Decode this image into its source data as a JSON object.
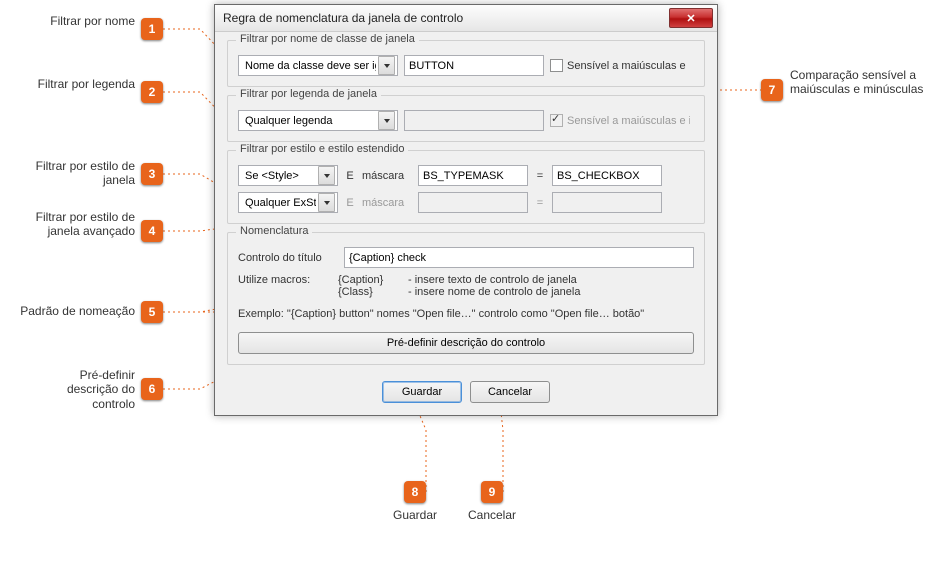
{
  "dialog": {
    "title": "Regra de nomenclatura da janela de controlo",
    "groups": {
      "classname": {
        "title": "Filtrar por nome de classe de janela",
        "combo": "Nome da classe deve ser igua",
        "value": "BUTTON",
        "case_label": "Sensível a maiúsculas e"
      },
      "caption": {
        "title": "Filtrar por legenda de janela",
        "combo": "Qualquer legenda",
        "value": "",
        "case_label": "Sensível a maiúsculas e i"
      },
      "style": {
        "title": "Filtrar por estilo e estilo estendido",
        "style_combo": "Se  <Style>",
        "and1": "E",
        "mask1_label": "máscara",
        "mask1_value": "BS_TYPEMASK",
        "eq1": "=",
        "val1_value": "BS_CHECKBOX",
        "exstyle_combo": "Qualquer ExStyl",
        "and2": "E",
        "mask2_label": "máscara",
        "mask2_value": "",
        "eq2": "=",
        "val2_value": ""
      },
      "nom": {
        "title": "Nomenclatura",
        "control_label": "Controlo do título",
        "control_value": "{Caption} check",
        "macros_label": "Utilize macros:",
        "macro1": "{Caption}",
        "macro2": "{Class}",
        "macro1_desc": "- insere texto de controlo de janela",
        "macro2_desc": "- insere nome de controlo de janela",
        "example": "Exemplo:   \"{Caption} button\" nomes \"Open file…\" controlo como \"Open file… botão\"",
        "predefine_btn": "Pré-definir descrição do controlo"
      }
    },
    "actions": {
      "save": "Guardar",
      "cancel": "Cancelar"
    }
  },
  "annotations": {
    "a1": "Filtrar por nome",
    "a2": "Filtrar por legenda",
    "a3": "Filtrar por estilo de janela",
    "a4": "Filtrar por estilo de janela avançado",
    "a5": "Padrão de nomeação",
    "a6": "Pré-definir descrição do controlo",
    "a7": "Comparação sensível a maiúsculas e minúsculas",
    "a8": "Guardar",
    "a9": "Cancelar"
  }
}
